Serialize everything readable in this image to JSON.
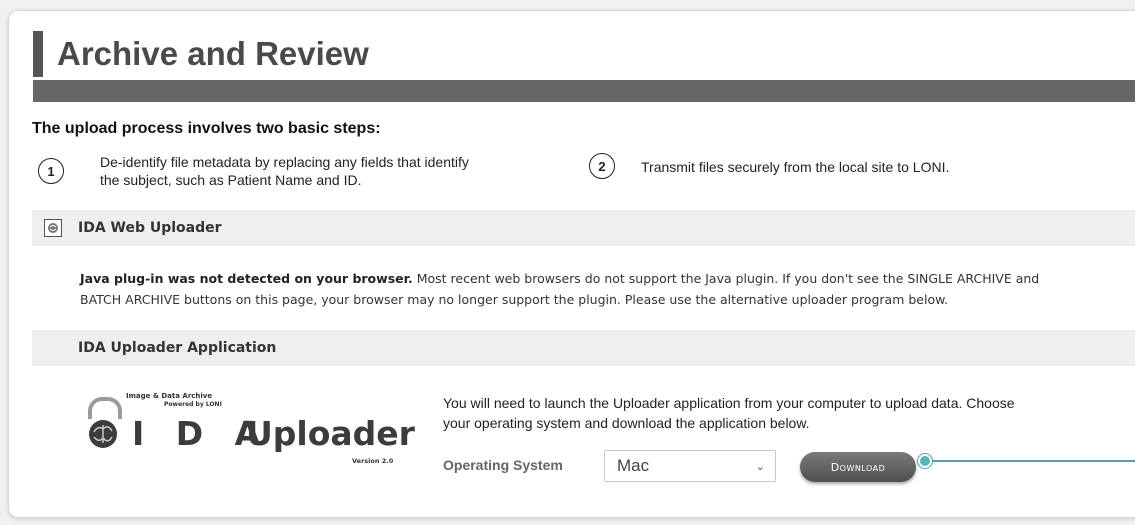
{
  "header": {
    "title": "Archive and Review"
  },
  "intro": "The upload process involves two basic steps:",
  "steps": [
    {
      "number": "1",
      "text": "De-identify file metadata by replacing any fields that identify the subject, such as Patient Name and ID."
    },
    {
      "number": "2",
      "text": "Transmit files securely from the local site to LONI."
    }
  ],
  "web_uploader": {
    "title": "IDA Web Uploader",
    "notice_bold": "Java plug-in was not detected on your browser.",
    "notice_text": " Most recent web browsers do not support the Java plugin. If you don't see the SINGLE ARCHIVE and BATCH ARCHIVE buttons on this page, your browser may no longer support the plugin. Please use the alternative uploader program below."
  },
  "app_section": {
    "title": "IDA Uploader Application",
    "logo": {
      "line1": "Image & Data Archive",
      "line2": "Powered by LONI",
      "ida": "I D A",
      "uploader": "Uploader",
      "version": "Version 2.0"
    },
    "description": "You will need to launch the Uploader application from your computer to upload data. Choose your operating system and download the application below.",
    "os_label": "Operating System",
    "os_selected": "Mac",
    "download_label": "Download"
  },
  "colors": {
    "callout": "#4fa3a6",
    "title_bar": "#555555"
  }
}
